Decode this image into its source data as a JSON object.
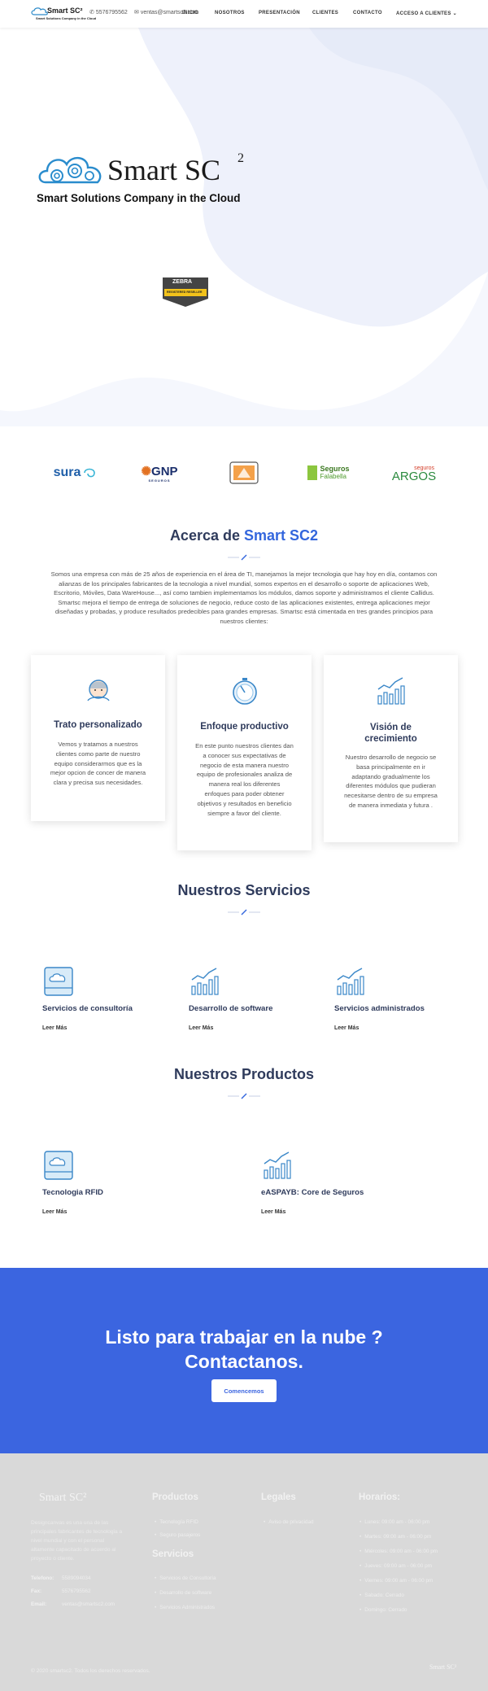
{
  "header": {
    "logo_text": "Smart SC²",
    "logo_tagline": "Smart Solutions Company in the Cloud",
    "phone": "5576795562",
    "email": "ventas@smartsc2.com",
    "nav": [
      "INICIO",
      "NOSOTROS",
      "PRESENTACIÓN",
      "CLIENTES",
      "CONTACTO",
      "ACCESO A CLIENTES"
    ]
  },
  "hero": {
    "brand": "Smart SC",
    "brand_sup": "2",
    "tagline": "Smart Solutions Company in the Cloud",
    "badge_brand": "ZEBRA",
    "badge_text": "REGISTERED RESELLER"
  },
  "clients": {
    "items": [
      {
        "name": "sura",
        "color": "#1f5fa9"
      },
      {
        "name": "GNP",
        "sub": "SEGUROS",
        "color": "#1a2e6b"
      },
      {
        "name": "",
        "color": "#e07b20"
      },
      {
        "name": "Seguros",
        "sub": "Falabella",
        "color": "#4c9a2a"
      },
      {
        "name": "ARGOS",
        "sub": "seguros",
        "color": "#2b8a3e"
      }
    ]
  },
  "about": {
    "title_prefix": "Acerca de",
    "title_accent": "Smart SC2",
    "text": "Somos una empresa con más de 25 años de experiencia en el área de TI, manejamos la mejor tecnologia que hay hoy en día, contamos con alianzas de los principales fabricantes de la tecnologia a nivel mundial, somos expertos en el desarrollo o soporte de aplicaciones Web, Escritorio, Móviles, Data WareHouse..., así como tambien implementamos los módulos, damos soporte y administramos el cliente Callidus. Smartsc mejora el tiempo de entrega de soluciones de negocio, reduce costo de las aplicaciones existentes, entrega aplicaciones mejor diseñadas y probadas, y produce resultados predecibles para grandes empresas. Smartsc está cimentada en tres grandes principios para nuestros clientes:"
  },
  "cards": [
    {
      "icon": "support-agent-icon",
      "title": "Trato personalizado",
      "text": "Vemos y tratamos a nuestros clientes como parte de nuestro equipo considerarmos que es la mejor opcion de concer de manera clara y precisa sus necesidades."
    },
    {
      "icon": "stopwatch-icon",
      "title": "Enfoque productivo",
      "text": "En este punto nuestros clientes dan a conocer sus expectativas de negocio de esta manera nuestro equipo de profesionales analiza de manera real los diferentes enfoques para poder obtener objetivos y resultados en beneficio siempre a favor del cliente."
    },
    {
      "icon": "growth-chart-icon",
      "title": "Visión de crecimiento",
      "text": "Nuestro desarrollo de negocio se basa principalmente en ir adaptando gradualmente los diferentes módulos que pudieran necesitarse dentro de su empresa de manera inmediata y futura ."
    }
  ],
  "services": {
    "title": "Nuestros Servicios",
    "items": [
      {
        "icon": "cloud-drive-icon",
        "title": "Servicios de consultoría",
        "link": "Leer Más"
      },
      {
        "icon": "growth-chart-icon",
        "title": "Desarrollo de software",
        "link": "Leer Más"
      },
      {
        "icon": "growth-chart-icon",
        "title": "Servicios administrados",
        "link": "Leer Más"
      }
    ]
  },
  "products": {
    "title": "Nuestros Productos",
    "items": [
      {
        "icon": "cloud-drive-icon",
        "title": "Tecnologia RFID",
        "link": "Leer Más"
      },
      {
        "icon": "growth-chart-icon",
        "title": "eASPAYB: Core de Seguros",
        "link": "Leer Más"
      }
    ]
  },
  "cta": {
    "title_line1": "Listo para trabajar en la nube ?",
    "title_line2": "Contactanos.",
    "button": "Comencemos",
    "color": "#3b65e0"
  },
  "footer": {
    "logo": "Smart SC²",
    "about": "Designcanvas es una una de las principales fabricantes de tecnologia a nivel mundial y con el personal altamente capacitado de acuerdo al proyecto o cliente.",
    "contact": [
      {
        "label": "Telefono:",
        "value": "5589094034"
      },
      {
        "label": "Fax:",
        "value": "5576795562"
      },
      {
        "label": "Email:",
        "value": "ventas@smartsc2.com"
      }
    ],
    "products_title": "Productos",
    "products": [
      "Tecnología RFID",
      "Seguro pasajeros"
    ],
    "services_title": "Servicios",
    "services": [
      "Servicios de Consultoría",
      "Desarrollo de software",
      "Servicios Administrados"
    ],
    "legal_title": "Legales",
    "legal": [
      "Aviso de privacidad"
    ],
    "hours_title": "Horarios:",
    "hours": [
      "Lunes: 09:00 am - 06:00 pm",
      "Martes: 09:00 am - 06:00 pm",
      "Miércoles: 09:00 am - 06:00 pm",
      "Jueves: 09:00 am - 06:00 pm",
      "Viernes: 09:00 am - 06:00 pm",
      "Sabado: Cerrado",
      "Domingo: Cerrado"
    ],
    "copyright": "© 2020 smartsc2. Todos los derechos reservados.",
    "bottom_logo": "Smart SC²"
  }
}
